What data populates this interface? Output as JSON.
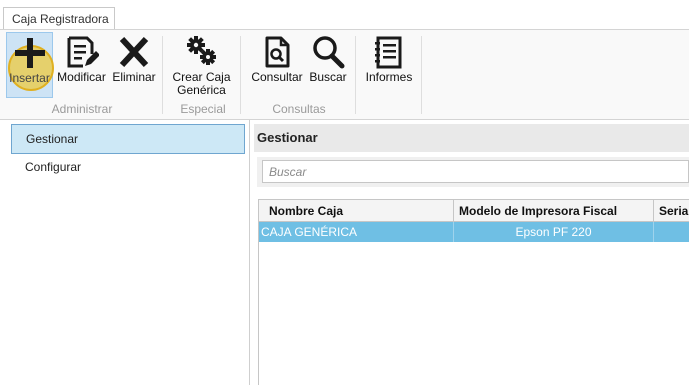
{
  "window": {
    "tab_label": "Caja Registradora"
  },
  "ribbon": {
    "buttons": [
      {
        "label": "Insertar",
        "icon": "plus-icon"
      },
      {
        "label": "Modificar",
        "icon": "edit-document-icon"
      },
      {
        "label": "Eliminar",
        "icon": "x-delete-icon"
      },
      {
        "label_line1": "Crear Caja",
        "label_line2": "Genérica",
        "icon": "gears-icon"
      },
      {
        "label": "Consultar",
        "icon": "document-search-icon"
      },
      {
        "label": "Buscar",
        "icon": "magnifier-icon"
      },
      {
        "label": "Informes",
        "icon": "report-notebook-icon"
      }
    ],
    "groups": [
      "Administrar",
      "Especial",
      "Consultas"
    ]
  },
  "nav": {
    "items": [
      "Gestionar",
      "Configurar"
    ],
    "active": "Gestionar"
  },
  "main": {
    "title": "Gestionar",
    "search_placeholder": "Buscar",
    "columns": [
      "Nombre Caja",
      "Modelo de Impresora Fiscal",
      "Serial"
    ],
    "rows": [
      [
        "CAJA GENÉRICA",
        "Epson PF 220",
        ""
      ]
    ]
  },
  "colors": {
    "selection_row": "#6fbfe4",
    "nav_active": "#cde8f6",
    "highlight": "#f0c832"
  }
}
